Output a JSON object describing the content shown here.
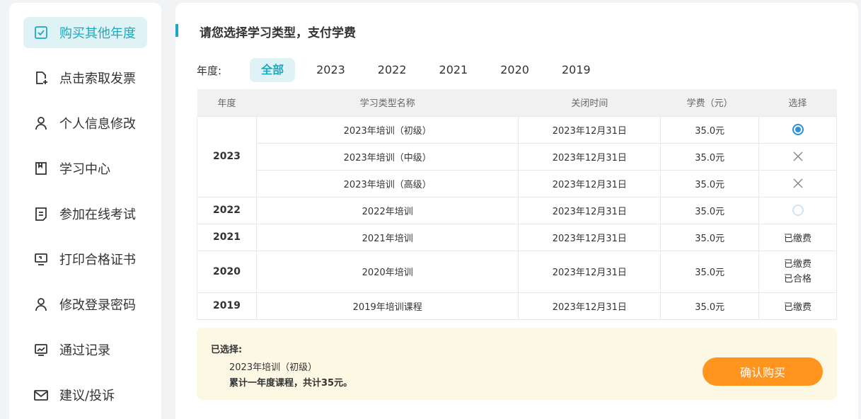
{
  "sidebar": {
    "items": [
      {
        "label": "购买其他年度",
        "icon": "checkbox-icon",
        "active": true
      },
      {
        "label": "点击索取发票",
        "icon": "invoice-add-icon"
      },
      {
        "label": "个人信息修改",
        "icon": "user-icon"
      },
      {
        "label": "学习中心",
        "icon": "bookmark-icon"
      },
      {
        "label": "参加在线考试",
        "icon": "exam-doc-icon"
      },
      {
        "label": "打印合格证书",
        "icon": "certificate-monitor-icon"
      },
      {
        "label": "修改登录密码",
        "icon": "user-lock-icon"
      },
      {
        "label": "通过记录",
        "icon": "chart-icon"
      },
      {
        "label": "建议/投诉",
        "icon": "mail-icon"
      }
    ]
  },
  "main": {
    "title": "请您选择学习类型，支付学费",
    "year_label": "年度:",
    "year_tabs": [
      "全部",
      "2023",
      "2022",
      "2021",
      "2020",
      "2019"
    ],
    "active_year_tab": "全部",
    "table": {
      "headers": [
        "年度",
        "学习类型名称",
        "关闭时间",
        "学费（元）",
        "选择"
      ],
      "rows": [
        {
          "year": "2023",
          "name": "2023年培训（初级）",
          "close": "2023年12月31日",
          "fee": "35.0元",
          "select": "radio-checked"
        },
        {
          "year": "",
          "name": "2023年培训（中级）",
          "close": "2023年12月31日",
          "fee": "35.0元",
          "select": "cross"
        },
        {
          "year": "",
          "name": "2023年培训（高级）",
          "close": "2023年12月31日",
          "fee": "35.0元",
          "select": "cross"
        },
        {
          "year": "2022",
          "name": "2022年培训",
          "close": "2023年12月31日",
          "fee": "35.0元",
          "select": "radio-empty"
        },
        {
          "year": "2021",
          "name": "2021年培训",
          "close": "2023年12月31日",
          "fee": "35.0元",
          "select": "text",
          "status": [
            "已缴费"
          ]
        },
        {
          "year": "2020",
          "name": "2020年培训",
          "close": "2023年12月31日",
          "fee": "35.0元",
          "select": "text",
          "status": [
            "已缴费",
            "已合格"
          ]
        },
        {
          "year": "2019",
          "name": "2019年培训课程",
          "close": "2023年12月31日",
          "fee": "35.0元",
          "select": "text",
          "status": [
            "已缴费"
          ]
        }
      ]
    },
    "summary": {
      "title": "已选择:",
      "item": "2023年培训（初级）",
      "total": "累计一年度课程，共计35元。",
      "confirm_label": "确认购买"
    }
  },
  "colors": {
    "accent": "#1aa9bd",
    "button": "#ff951f",
    "summary_bg": "#fdf8e4",
    "radio": "#2f8fd8"
  }
}
